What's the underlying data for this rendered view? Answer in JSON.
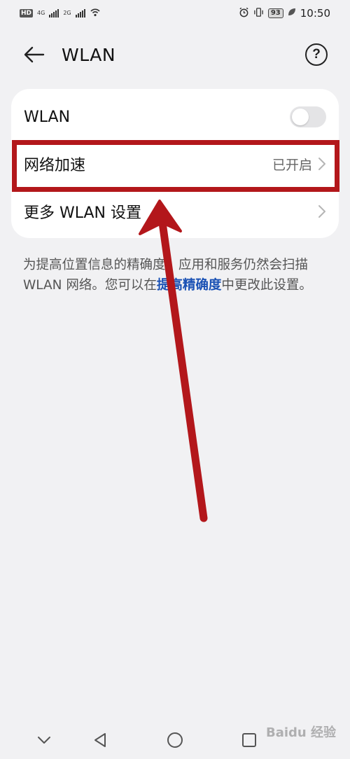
{
  "status_bar": {
    "hd_badge": "HD",
    "net_4g": "4G",
    "net_2g": "2G",
    "battery": "93",
    "time": "10:50",
    "icons": [
      "hd-icon",
      "signal-icon",
      "wifi-hotspot-icon",
      "alarm-icon",
      "vibrate-icon",
      "battery-icon",
      "leaf-icon"
    ]
  },
  "header": {
    "title": "WLAN",
    "back_icon": "back-arrow-icon",
    "help_icon": "help-icon",
    "help_glyph": "?"
  },
  "settings": {
    "wlan_label": "WLAN",
    "wlan_toggle_on": false,
    "accel_label": "网络加速",
    "accel_value": "已开启",
    "more_label": "更多 WLAN 设置"
  },
  "description": {
    "text_before": "为提高位置信息的精确度，应用和服务仍然会扫描 WLAN 网络。您可以在",
    "link": "提高精确度",
    "text_after": "中更改此设置。"
  },
  "annotation": {
    "highlight_color": "#b3171b"
  },
  "colors": {
    "background": "#f1f1f3",
    "card": "#ffffff",
    "link": "#1b52b5",
    "annotation_red": "#b3171b"
  },
  "watermark": "Baidu 经验"
}
